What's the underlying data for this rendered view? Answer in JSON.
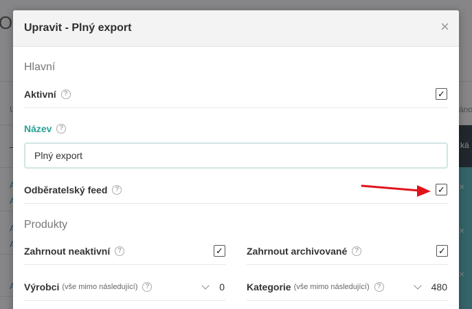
{
  "background": {
    "title_fragment": "O",
    "col_left": "U",
    "col_right": "áno",
    "dash": "–",
    "dark_text": "ká",
    "links": [
      "A",
      "A",
      "A",
      "A",
      "A"
    ]
  },
  "modal": {
    "title": "Upravit - Plný export",
    "close": "×",
    "sections": {
      "main": "Hlavní",
      "products": "Produkty"
    },
    "fields": {
      "active": {
        "label": "Aktivní",
        "checked": true
      },
      "name": {
        "label": "Název",
        "value": "Plný export"
      },
      "subscriber_feed": {
        "label": "Odběratelský feed",
        "checked": true
      },
      "include_inactive": {
        "label": "Zahrnout neaktivní",
        "checked": true
      },
      "include_archived": {
        "label": "Zahrnout archivované",
        "checked": true
      },
      "manufacturers": {
        "label": "Výrobci",
        "note": "(vše mimo následující)",
        "count": "0"
      },
      "categories": {
        "label": "Kategorie",
        "note": "(vše mimo následující)",
        "count": "480"
      }
    },
    "help_glyph": "?",
    "check_glyph": "✓"
  },
  "colors": {
    "accent_teal": "#2aa198",
    "arrow_red": "#e0141a",
    "input_border": "#cfe6e4"
  },
  "icons": {
    "close": "close-icon",
    "help": "help-icon",
    "check": "check-icon",
    "chevron": "chevron-down-icon",
    "annotation": "red-arrow-icon"
  }
}
